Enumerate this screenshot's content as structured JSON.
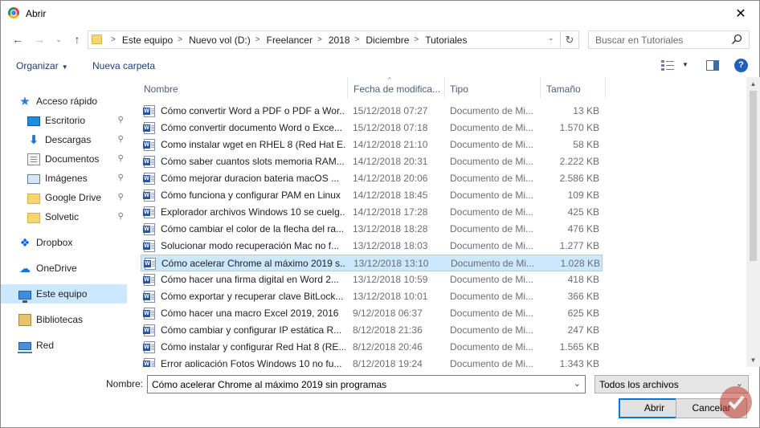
{
  "window": {
    "title": "Abrir",
    "close_symbol": "✕"
  },
  "nav": {
    "back": "←",
    "forward": "→",
    "history": "⌄",
    "up": "↑"
  },
  "address": {
    "crumbs": [
      "Este equipo",
      "Nuevo vol (D:)",
      "Freelancer",
      "2018",
      "Diciembre",
      "Tutoriales"
    ],
    "separator": ">",
    "dropdown": "⌄",
    "refresh": "↻"
  },
  "search": {
    "placeholder": "Buscar en Tutoriales"
  },
  "toolbar": {
    "organize": "Organizar",
    "organize_caret": "▼",
    "new_folder": "Nueva carpeta",
    "view_caret": "▼",
    "help": "?"
  },
  "sidebar": {
    "items": [
      {
        "label": "Acceso rápido",
        "icon": "star-icon",
        "glyph": "★"
      },
      {
        "label": "Escritorio",
        "icon": "desktop-icon",
        "pinned": true
      },
      {
        "label": "Descargas",
        "icon": "download-icon",
        "glyph": "⬇",
        "pinned": true
      },
      {
        "label": "Documentos",
        "icon": "documents-icon",
        "pinned": true
      },
      {
        "label": "Imágenes",
        "icon": "images-icon",
        "pinned": true
      },
      {
        "label": "Google Drive",
        "icon": "folder-icon",
        "pinned": true
      },
      {
        "label": "Solvetic",
        "icon": "folder-icon",
        "pinned": true
      },
      {
        "label": "Dropbox",
        "icon": "dropbox-icon",
        "glyph": "❖"
      },
      {
        "label": "OneDrive",
        "icon": "cloud-icon",
        "glyph": "☁"
      },
      {
        "label": "Este equipo",
        "icon": "computer-icon",
        "selected": true
      },
      {
        "label": "Bibliotecas",
        "icon": "libraries-icon"
      },
      {
        "label": "Red",
        "icon": "network-icon"
      }
    ],
    "pin_glyph": "📌"
  },
  "columns": {
    "name": "Nombre",
    "date": "Fecha de modifica...",
    "type": "Tipo",
    "size": "Tamaño",
    "sort_arrow": "^"
  },
  "files": [
    {
      "name": "Cómo convertir Word a PDF o PDF a Wor...",
      "date": "15/12/2018 07:27",
      "type": "Documento de Mi...",
      "size": "13 KB"
    },
    {
      "name": "Cómo convertir documento Word o Exce...",
      "date": "15/12/2018 07:18",
      "type": "Documento de Mi...",
      "size": "1.570 KB"
    },
    {
      "name": "Como instalar wget en RHEL 8 (Red Hat E...",
      "date": "14/12/2018 21:10",
      "type": "Documento de Mi...",
      "size": "58 KB"
    },
    {
      "name": "Cómo saber cuantos slots memoria RAM...",
      "date": "14/12/2018 20:31",
      "type": "Documento de Mi...",
      "size": "2.222 KB"
    },
    {
      "name": "Cómo mejorar duracion bateria macOS ...",
      "date": "14/12/2018 20:06",
      "type": "Documento de Mi...",
      "size": "2.586 KB"
    },
    {
      "name": "Cómo funciona y configurar PAM en Linux",
      "date": "14/12/2018 18:45",
      "type": "Documento de Mi...",
      "size": "109 KB"
    },
    {
      "name": "Explorador archivos Windows 10 se cuelg...",
      "date": "14/12/2018 17:28",
      "type": "Documento de Mi...",
      "size": "425 KB"
    },
    {
      "name": "Cómo cambiar el color de la flecha del ra...",
      "date": "13/12/2018 18:28",
      "type": "Documento de Mi...",
      "size": "476 KB"
    },
    {
      "name": "Solucionar modo recuperación Mac no f...",
      "date": "13/12/2018 18:03",
      "type": "Documento de Mi...",
      "size": "1.277 KB"
    },
    {
      "name": "Cómo acelerar Chrome al máximo 2019 s...",
      "date": "13/12/2018 13:10",
      "type": "Documento de Mi...",
      "size": "1.028 KB",
      "selected": true
    },
    {
      "name": "Cómo hacer una firma digital en Word 2...",
      "date": "13/12/2018 10:59",
      "type": "Documento de Mi...",
      "size": "418 KB"
    },
    {
      "name": "Cómo exportar y recuperar clave BitLock...",
      "date": "13/12/2018 10:01",
      "type": "Documento de Mi...",
      "size": "366 KB"
    },
    {
      "name": "Cómo hacer una macro Excel 2019, 2016",
      "date": "9/12/2018 06:37",
      "type": "Documento de Mi...",
      "size": "625 KB"
    },
    {
      "name": "Cómo cambiar y configurar IP estática R...",
      "date": "8/12/2018 21:36",
      "type": "Documento de Mi...",
      "size": "247 KB"
    },
    {
      "name": "Cómo instalar y configurar Red Hat 8 (RE...",
      "date": "8/12/2018 20:46",
      "type": "Documento de Mi...",
      "size": "1.565 KB"
    },
    {
      "name": "Error aplicación Fotos Windows 10 no fu...",
      "date": "8/12/2018 19:24",
      "type": "Documento de Mi...",
      "size": "1.343 KB"
    }
  ],
  "scrollbar": {
    "up": "▲",
    "down": "▼"
  },
  "footer": {
    "name_label": "Nombre:",
    "name_value": "Cómo acelerar Chrome al máximo 2019 sin programas",
    "name_dropdown": "⌄",
    "filetype_value": "Todos los archivos",
    "filetype_dropdown": "⌄",
    "open_label": "Abrir",
    "cancel_label": "Cancelar"
  }
}
